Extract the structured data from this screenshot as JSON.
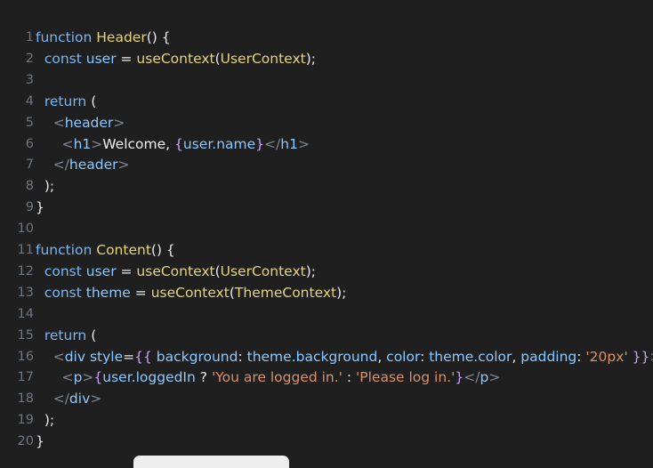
{
  "editor": {
    "lines": [
      {
        "n": "1",
        "tokens": [
          [
            "kw",
            "function "
          ],
          [
            "fn",
            "Header"
          ],
          [
            "pn",
            "() {"
          ]
        ]
      },
      {
        "n": "2",
        "tokens": [
          [
            "kw",
            "  const "
          ],
          [
            "var",
            "user"
          ],
          [
            "op",
            " = "
          ],
          [
            "fn",
            "useContext"
          ],
          [
            "pn",
            "("
          ],
          [
            "ty",
            "UserContext"
          ],
          [
            "pn",
            ");"
          ]
        ]
      },
      {
        "n": "3",
        "tokens": []
      },
      {
        "n": "4",
        "tokens": [
          [
            "kw",
            "  return "
          ],
          [
            "pn",
            "("
          ]
        ]
      },
      {
        "n": "5",
        "tokens": [
          [
            "br",
            "    <"
          ],
          [
            "tag",
            "header"
          ],
          [
            "br",
            ">"
          ]
        ]
      },
      {
        "n": "6",
        "tokens": [
          [
            "br",
            "      <"
          ],
          [
            "tag",
            "h1"
          ],
          [
            "br",
            ">"
          ],
          [
            "txt",
            "Welcome, "
          ],
          [
            "brace",
            "{"
          ],
          [
            "var",
            "user.name"
          ],
          [
            "brace",
            "}"
          ],
          [
            "br",
            "</"
          ],
          [
            "tag",
            "h1"
          ],
          [
            "br",
            ">"
          ]
        ]
      },
      {
        "n": "7",
        "tokens": [
          [
            "br",
            "    </"
          ],
          [
            "tag",
            "header"
          ],
          [
            "br",
            ">"
          ]
        ]
      },
      {
        "n": "8",
        "tokens": [
          [
            "pn",
            "  );"
          ]
        ]
      },
      {
        "n": "9",
        "tokens": [
          [
            "pn",
            "}"
          ]
        ]
      },
      {
        "n": "10",
        "tokens": []
      },
      {
        "n": "11",
        "tokens": [
          [
            "kw",
            "function "
          ],
          [
            "fn",
            "Content"
          ],
          [
            "pn",
            "() {"
          ]
        ]
      },
      {
        "n": "12",
        "tokens": [
          [
            "kw",
            "  const "
          ],
          [
            "var",
            "user"
          ],
          [
            "op",
            " = "
          ],
          [
            "fn",
            "useContext"
          ],
          [
            "pn",
            "("
          ],
          [
            "ty",
            "UserContext"
          ],
          [
            "pn",
            ");"
          ]
        ]
      },
      {
        "n": "13",
        "tokens": [
          [
            "kw",
            "  const "
          ],
          [
            "var",
            "theme"
          ],
          [
            "op",
            " = "
          ],
          [
            "fn",
            "useContext"
          ],
          [
            "pn",
            "("
          ],
          [
            "ty",
            "ThemeContext"
          ],
          [
            "pn",
            ");"
          ]
        ]
      },
      {
        "n": "14",
        "tokens": []
      },
      {
        "n": "15",
        "tokens": [
          [
            "kw",
            "  return "
          ],
          [
            "pn",
            "("
          ]
        ]
      },
      {
        "n": "16",
        "tokens": [
          [
            "br",
            "    <"
          ],
          [
            "tag",
            "div "
          ],
          [
            "var",
            "style"
          ],
          [
            "op",
            "="
          ],
          [
            "brace",
            "{{ "
          ],
          [
            "var",
            "background"
          ],
          [
            "op",
            ": "
          ],
          [
            "var",
            "theme.background"
          ],
          [
            "op",
            ", "
          ],
          [
            "var",
            "color"
          ],
          [
            "op",
            ": "
          ],
          [
            "var",
            "theme.color"
          ],
          [
            "op",
            ", "
          ],
          [
            "var",
            "padding"
          ],
          [
            "op",
            ": "
          ],
          [
            "str",
            "'20px'"
          ],
          [
            "brace",
            " }}"
          ],
          [
            "br",
            ">"
          ]
        ]
      },
      {
        "n": "17",
        "tokens": [
          [
            "br",
            "      <"
          ],
          [
            "tag",
            "p"
          ],
          [
            "br",
            ">"
          ],
          [
            "brace",
            "{"
          ],
          [
            "var",
            "user.loggedIn"
          ],
          [
            "op",
            " ? "
          ],
          [
            "str",
            "'You are logged in.'"
          ],
          [
            "op",
            " : "
          ],
          [
            "str",
            "'Please log in.'"
          ],
          [
            "brace",
            "}"
          ],
          [
            "br",
            "</"
          ],
          [
            "tag",
            "p"
          ],
          [
            "br",
            ">"
          ]
        ]
      },
      {
        "n": "18",
        "tokens": [
          [
            "br",
            "    </"
          ],
          [
            "tag",
            "div"
          ],
          [
            "br",
            ">"
          ]
        ]
      },
      {
        "n": "19",
        "tokens": [
          [
            "pn",
            "  );"
          ]
        ]
      },
      {
        "n": "20",
        "tokens": [
          [
            "pn",
            "}"
          ]
        ]
      }
    ]
  }
}
